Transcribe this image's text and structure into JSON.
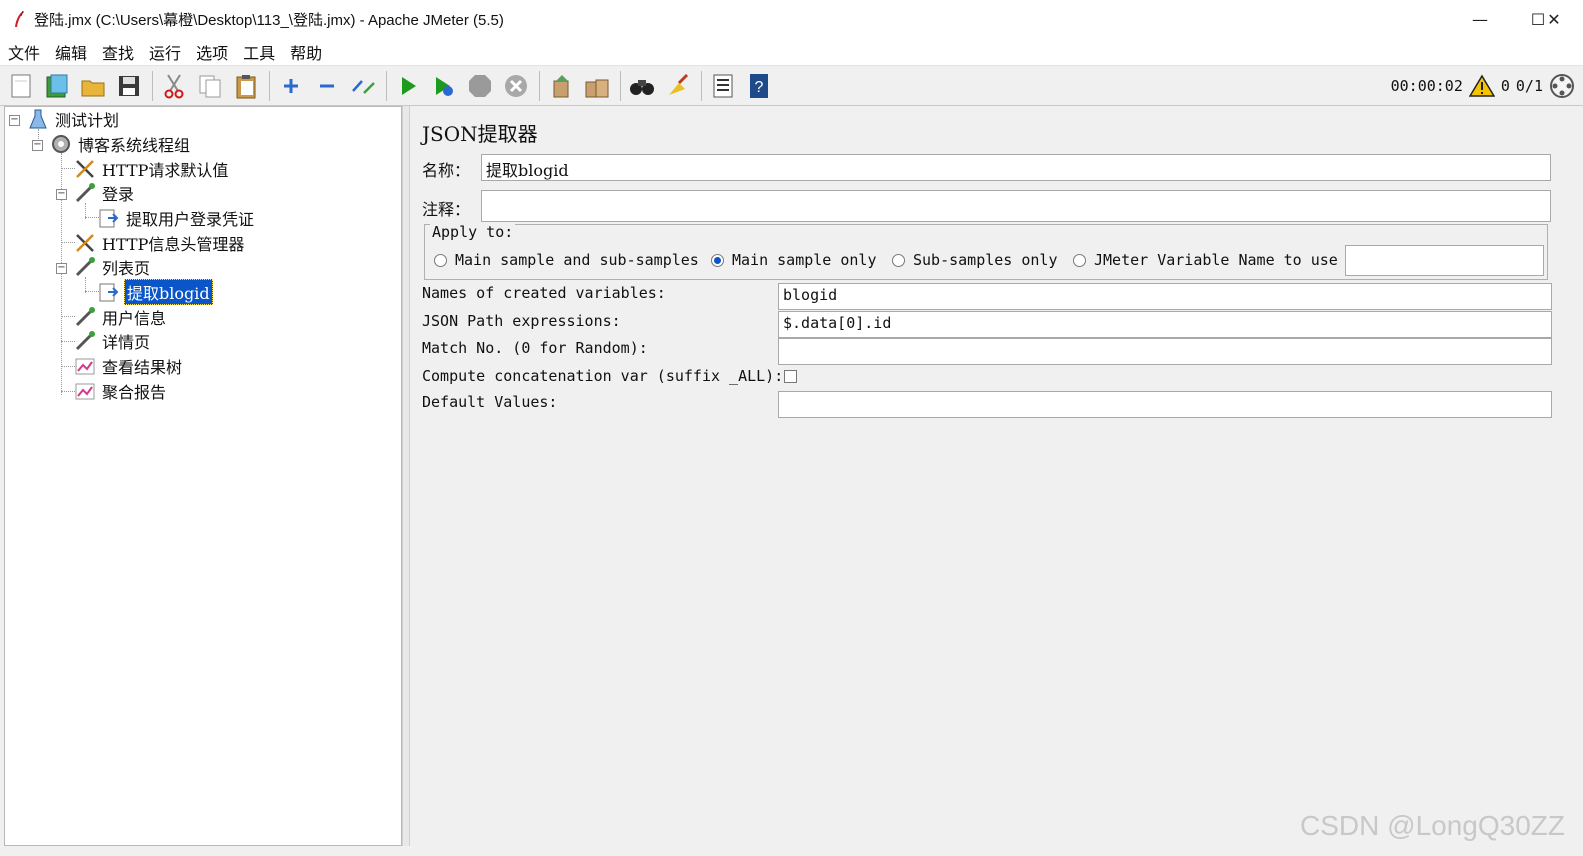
{
  "window": {
    "title": "登陆.jmx (C:\\Users\\幕橙\\Desktop\\113_\\登陆.jmx) - Apache JMeter (5.5)",
    "minimize_glyph": "—",
    "maximize_glyph": "☐",
    "close_glyph": "✕"
  },
  "menu": [
    "文件",
    "编辑",
    "查找",
    "运行",
    "选项",
    "工具",
    "帮助"
  ],
  "toolbar": {
    "icons": [
      "new-icon",
      "templates-icon",
      "open-icon",
      "save-icon",
      "cut-icon",
      "copy-icon",
      "paste-icon",
      "expand-icon",
      "collapse-icon",
      "toggle-icon",
      "start-icon",
      "start-no-pause-icon",
      "stop-icon",
      "shutdown-icon",
      "clear-icon",
      "clear-all-icon",
      "search-icon",
      "reset-search-icon",
      "function-helper-icon",
      "help-icon"
    ],
    "timer": "00:00:02",
    "warning_count": "0",
    "threads": "0/1"
  },
  "tree": {
    "items": [
      {
        "label": "测试计划",
        "icon": "test-plan-icon",
        "depth": 0
      },
      {
        "label": "博客系统线程组",
        "icon": "thread-group-icon",
        "depth": 1
      },
      {
        "label": "HTTP请求默认值",
        "icon": "config-element-icon",
        "depth": 2
      },
      {
        "label": "登录",
        "icon": "sampler-icon",
        "depth": 2
      },
      {
        "label": "提取用户登录凭证",
        "icon": "extractor-icon",
        "depth": 3
      },
      {
        "label": "HTTP信息头管理器",
        "icon": "config-element-icon",
        "depth": 2
      },
      {
        "label": "列表页",
        "icon": "sampler-icon",
        "depth": 2
      },
      {
        "label": "提取blogid",
        "icon": "extractor-icon",
        "depth": 3
      },
      {
        "label": "用户信息",
        "icon": "sampler-icon",
        "depth": 2
      },
      {
        "label": "详情页",
        "icon": "sampler-icon",
        "depth": 2
      },
      {
        "label": "查看结果树",
        "icon": "listener-icon",
        "depth": 2
      },
      {
        "label": "聚合报告",
        "icon": "listener-icon",
        "depth": 2
      }
    ],
    "selected": "提取blogid"
  },
  "panel": {
    "title": "JSON提取器",
    "name_label": "名称：",
    "name_value": "提取blogid",
    "comment_label": "注释：",
    "comment_value": "",
    "apply_to": {
      "legend": "Apply to:",
      "options": [
        "Main sample and sub-samples",
        "Main sample only",
        "Sub-samples only",
        "JMeter Variable Name to use"
      ],
      "selected": "Main sample only",
      "variable_value": ""
    },
    "fields": {
      "names_label": "Names of created variables:",
      "names_value": "blogid",
      "jsonpath_label": "JSON Path expressions:",
      "jsonpath_value": "$.data[0].id",
      "match_label": "Match No. (0 for Random):",
      "match_value": "",
      "concat_label": "Compute concatenation var (suffix _ALL):",
      "concat_checked": false,
      "default_label": "Default Values:",
      "default_value": ""
    }
  },
  "watermark": "CSDN @LongQ30ZZ",
  "colors": {
    "selection": "#0a55c8",
    "run_green": "#1e9a1e",
    "stop_gray": "#9a9a9a"
  }
}
